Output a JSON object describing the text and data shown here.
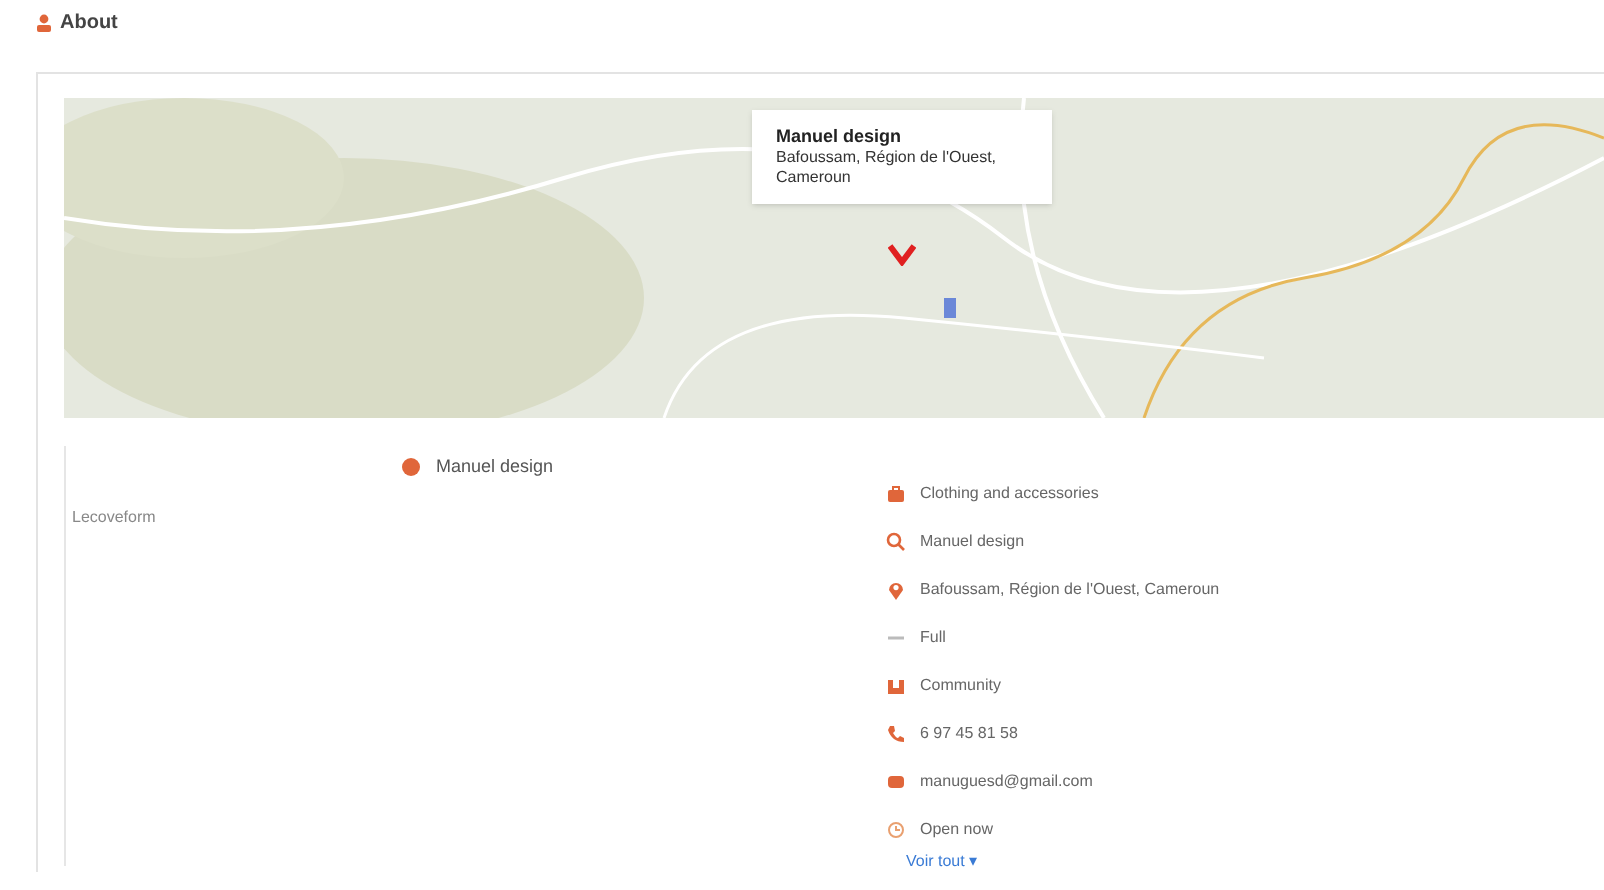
{
  "header": {
    "title": "About"
  },
  "map": {
    "popup": {
      "title": "Manuel design",
      "address": "Bafoussam, Région de l'Ouest, Cameroun"
    }
  },
  "business": {
    "name": "Manuel design",
    "note": "Lecoveform"
  },
  "details": [
    {
      "kind": "category",
      "text": "Clothing and accessories"
    },
    {
      "kind": "search",
      "text": "Manuel design"
    },
    {
      "kind": "location",
      "text": "Bafoussam, Région de l'Ouest, Cameroun"
    },
    {
      "kind": "price",
      "text": "Full"
    },
    {
      "kind": "people",
      "text": "Community"
    },
    {
      "kind": "phone",
      "text": "6 97 45 81 58"
    },
    {
      "kind": "email",
      "text": "manuguesd@gmail.com"
    },
    {
      "kind": "hours",
      "text": "Open now"
    }
  ],
  "more_link": "Voir tout ▾"
}
